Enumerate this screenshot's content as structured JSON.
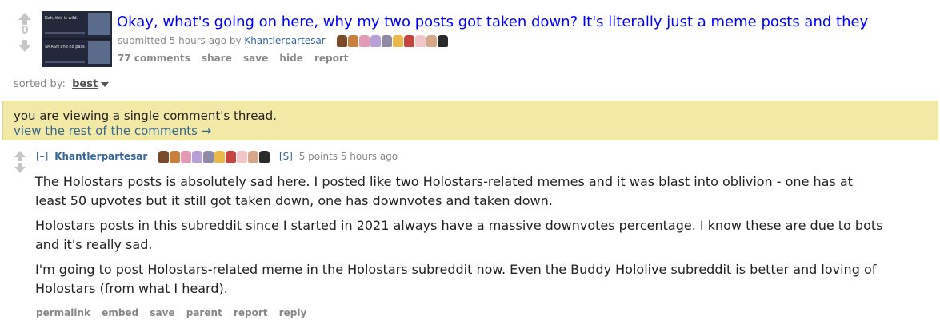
{
  "post": {
    "score": "0",
    "thumbnail": {
      "panel1_text": "Nah, this is wild.",
      "panel2_text": "SMASH and no pass"
    },
    "title": "Okay, what's going on here, why my two posts got taken down? It's literally just a meme posts and they",
    "tagline_prefix": "submitted 5 hours ago by",
    "author": "Khantlerpartesar",
    "flair_colors": [
      "#7a4a2a",
      "#c97f3d",
      "#e29ab5",
      "#b7a0d8",
      "#8f8aa8",
      "#e9b949",
      "#c5463e",
      "#f0c6c6",
      "#d7a78a",
      "#2a2a2a"
    ],
    "buttons": [
      "77 comments",
      "share",
      "save",
      "hide",
      "report"
    ]
  },
  "sort": {
    "label": "sorted by:",
    "value": "best"
  },
  "notice": {
    "line1": "you are viewing a single comment's thread.",
    "line2": "view the rest of the comments →"
  },
  "comment": {
    "collapse": "[–]",
    "author": "Khantlerpartesar",
    "submitter_tag": "[S]",
    "points_time": "5 points 5 hours ago",
    "paragraphs": [
      "The Holostars posts is absolutely sad here. I posted like two Holostars-related memes and it was blast into oblivion - one has at least 50 upvotes but it still got taken down, one has downvotes and taken down.",
      "Holostars posts in this subreddit since I started in 2021 always have a massive downvotes percentage. I know these are due to bots and it's really sad.",
      "I'm going to post Holostars-related meme in the Holostars subreddit now. Even the Buddy Hololive subreddit is better and loving of Holostars (from what I heard)."
    ],
    "buttons": [
      "permalink",
      "embed",
      "save",
      "parent",
      "report",
      "reply"
    ]
  }
}
